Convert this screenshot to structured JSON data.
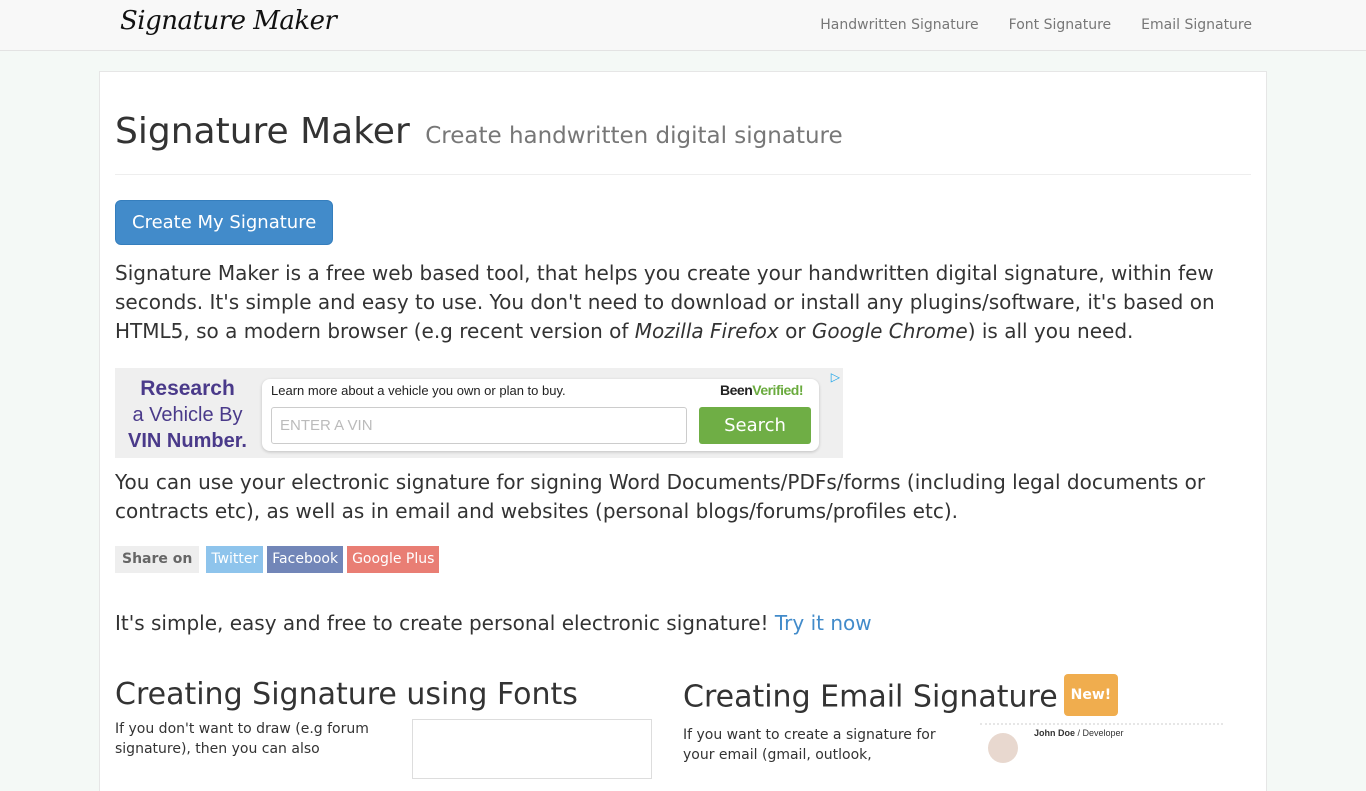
{
  "navbar": {
    "brand": "Signature Maker",
    "links": [
      "Handwritten Signature",
      "Font Signature",
      "Email Signature"
    ]
  },
  "header": {
    "title": "Signature Maker",
    "subtitle": "Create handwritten digital signature"
  },
  "create_button": "Create My Signature",
  "intro": {
    "part1": "Signature Maker is a free web based tool, that helps you create your handwritten digital signature, within few seconds. It's simple and easy to use. You don't need to download or install any plugins/software, it's based on HTML5, so a modern browser (e.g recent version of ",
    "browser1": "Mozilla Firefox",
    "part2": " or ",
    "browser2": "Google Chrome",
    "part3": ") is all you need."
  },
  "ad": {
    "left_line1": "Research",
    "left_line2": "a Vehicle By",
    "left_line3": "VIN Number.",
    "learn_text": "Learn more about a vehicle you own or plan to buy.",
    "brand_part1": "Been",
    "brand_part2": "Verified!",
    "input_placeholder": "ENTER A VIN",
    "search_label": "Search",
    "adchoices_icon": "▷"
  },
  "usage_text": "You can use your electronic signature for signing Word Documents/PDFs/forms (including legal documents or contracts etc), as well as in email and websites (personal blogs/forums/profiles etc).",
  "share": {
    "label": "Share on",
    "buttons": [
      "Twitter",
      "Facebook",
      "Google Plus"
    ]
  },
  "cta": {
    "text": "It's simple, easy and free to create personal electronic signature! ",
    "link": "Try it now"
  },
  "sections": [
    {
      "title": "Creating Signature using Fonts",
      "text": "If you don't want to draw (e.g forum signature), then you can also"
    },
    {
      "title": "Creating Email Signature",
      "badge": "New!",
      "text": "If you want to create a signature for your email (gmail, outlook,",
      "preview_name": "John Doe",
      "preview_role": " / Developer"
    }
  ]
}
